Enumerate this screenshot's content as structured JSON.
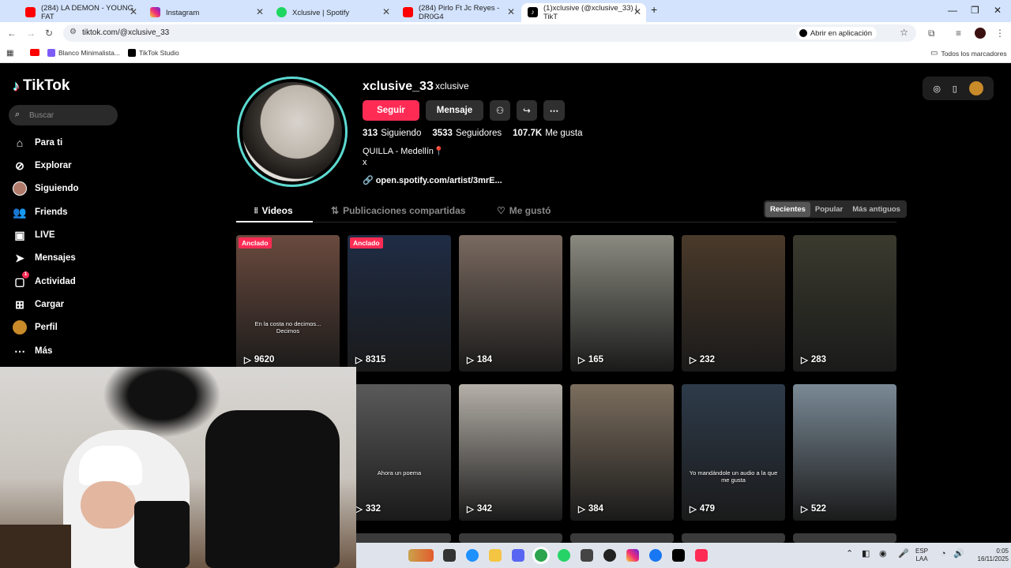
{
  "browser": {
    "tabs": [
      {
        "title": "(284) LA DEMON - YOUNG FAT",
        "color": "#ff0000"
      },
      {
        "title": "Instagram",
        "color": "#d6249f"
      },
      {
        "title": "Xclusive | Spotify",
        "color": "#1ed760"
      },
      {
        "title": "(284) Pirlo Ft Jc Reyes - DR0G4",
        "color": "#ff0000"
      },
      {
        "title": "(1)xclusive (@xclusive_33) | TikT",
        "color": "#000000"
      }
    ],
    "new_tab": "+",
    "url": "tiktok.com/@xclusive_33",
    "open_in_app": "Abrir en aplicación",
    "bookmarks": [
      {
        "label": "Blanco Minimalista..."
      },
      {
        "label": "TikTok Studio"
      }
    ],
    "all_bookmarks": "Todos los marcadores"
  },
  "tiktok": {
    "logo": "TikTok",
    "search_placeholder": "Buscar",
    "nav": [
      {
        "label": "Para ti",
        "icon": "home-icon"
      },
      {
        "label": "Explorar",
        "icon": "compass-icon"
      },
      {
        "label": "Siguiendo",
        "icon": "following-avatar-icon"
      },
      {
        "label": "Friends",
        "icon": "friends-icon"
      },
      {
        "label": "LIVE",
        "icon": "live-icon"
      },
      {
        "label": "Mensajes",
        "icon": "messages-icon"
      },
      {
        "label": "Actividad",
        "icon": "activity-icon",
        "badge": "1"
      },
      {
        "label": "Cargar",
        "icon": "upload-icon"
      },
      {
        "label": "Perfil",
        "icon": "profile-avatar-icon"
      },
      {
        "label": "Más",
        "icon": "more-icon"
      }
    ]
  },
  "profile": {
    "username": "xclusive_33",
    "nickname": "xclusive",
    "follow_label": "Seguir",
    "message_label": "Mensaje",
    "following_count": "313",
    "following_label": "Siguiendo",
    "followers_count": "3533",
    "followers_label": "Seguidores",
    "likes_count": "107.7K",
    "likes_label": "Me gusta",
    "bio_line1": "QUILLA - Medellín📍",
    "bio_line2": "x",
    "link": "open.spotify.com/artist/3mrE...",
    "tabs": {
      "videos": "Videos",
      "reposts": "Publicaciones compartidas",
      "liked": "Me gustó"
    },
    "sort": {
      "recent": "Recientes",
      "popular": "Popular",
      "oldest": "Más antiguos"
    },
    "pinned_label": "Anclado",
    "videos": [
      {
        "views": "9620",
        "pinned": true,
        "caption": "En la costa no decimos... Decimos",
        "bg": "#6a4a3e"
      },
      {
        "views": "8315",
        "pinned": true,
        "caption": "",
        "bg": "#1f2c44"
      },
      {
        "views": "184",
        "pinned": false,
        "caption": "",
        "bg": "#7a6a60"
      },
      {
        "views": "165",
        "pinned": false,
        "caption": "",
        "bg": "#8a8a80"
      },
      {
        "views": "232",
        "pinned": false,
        "caption": "",
        "bg": "#4a3a2a"
      },
      {
        "views": "283",
        "pinned": false,
        "caption": "",
        "bg": "#3a3a2e"
      },
      {
        "views": "332",
        "pinned": false,
        "caption": "Ahora un poema",
        "bg": "#5a5a5a"
      },
      {
        "views": "342",
        "pinned": false,
        "caption": "",
        "bg": "#b5b0a8"
      },
      {
        "views": "384",
        "pinned": false,
        "caption": "",
        "bg": "#7b6e5e"
      },
      {
        "views": "479",
        "pinned": false,
        "caption": "Yo mandándole un audio a la que me gusta",
        "bg": "#2e3b4a"
      },
      {
        "views": "522",
        "pinned": false,
        "caption": "",
        "bg": "#7a8a96"
      }
    ]
  },
  "taskbar": {
    "lang": "ESP",
    "lang2": "LAA",
    "time": "0:05",
    "date": "16/11/2025"
  },
  "colors": {
    "accent": "#fe2c55",
    "ring": "#5ddad1"
  }
}
